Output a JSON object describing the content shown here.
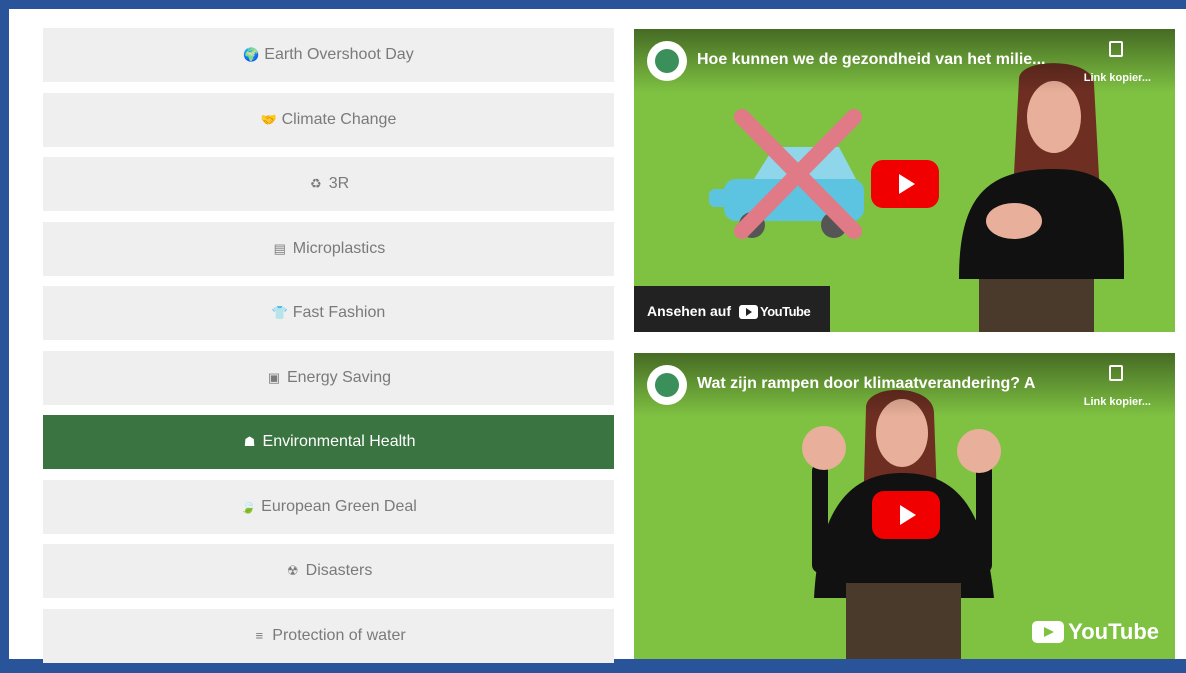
{
  "menu": {
    "items": [
      {
        "icon": "globe-icon",
        "glyph": "🌍",
        "label": "Earth Overshoot Day",
        "active": false
      },
      {
        "icon": "handshake-icon",
        "glyph": "🤝",
        "label": "Climate Change",
        "active": false
      },
      {
        "icon": "recycle-icon",
        "glyph": "♻",
        "label": "3R",
        "active": false
      },
      {
        "icon": "microplastics-icon",
        "glyph": "▤",
        "label": "Microplastics",
        "active": false
      },
      {
        "icon": "tshirt-icon",
        "glyph": "👕",
        "label": "Fast Fashion",
        "active": false
      },
      {
        "icon": "energy-icon",
        "glyph": "▣",
        "label": "Energy Saving",
        "active": false
      },
      {
        "icon": "hand-holding-person-icon",
        "glyph": "☗",
        "label": "Environmental Health",
        "active": true
      },
      {
        "icon": "leaf-icon",
        "glyph": "🍃",
        "label": "European Green Deal",
        "active": false
      },
      {
        "icon": "radiation-icon",
        "glyph": "☢",
        "label": "Disasters",
        "active": false
      },
      {
        "icon": "water-icon",
        "glyph": "≡",
        "label": "Protection of water",
        "active": false
      }
    ]
  },
  "videos": [
    {
      "title": "Hoe kunnen we de gezondheid van het milie...",
      "copy_label": "Link kopier...",
      "watch_label": "Ansehen auf",
      "watch_brand": "YouTube"
    },
    {
      "title": "Wat zijn rampen door klimaatverandering? A",
      "copy_label": "Link kopier...",
      "brand": "YouTube"
    }
  ],
  "colors": {
    "frame": "#2a5499",
    "active_item": "#3a7440",
    "item_bg": "#efefef",
    "video_bg": "#7fc242",
    "play_red": "#f00000"
  }
}
